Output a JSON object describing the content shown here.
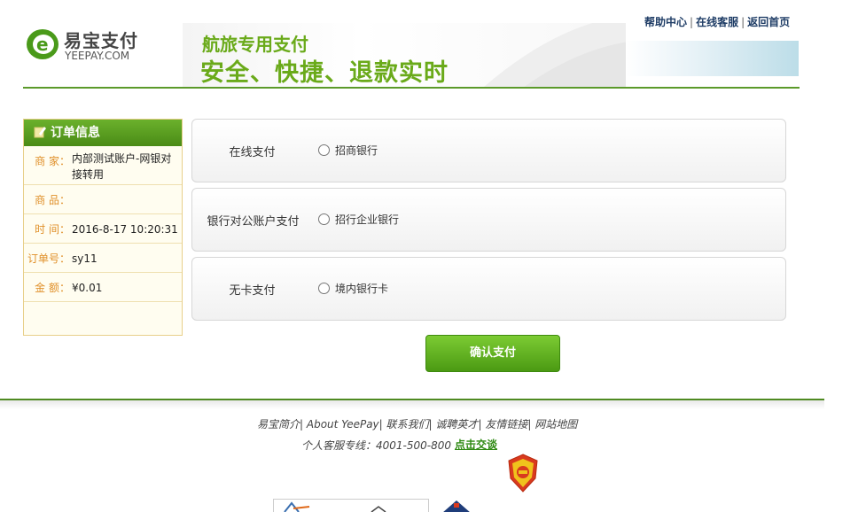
{
  "logo": {
    "cn": "易宝支付",
    "en": "YEEPAY.COM"
  },
  "banner": {
    "line1": "航旅专用支付",
    "line2": "安全、快捷、退款实时"
  },
  "top_links": [
    "帮助中心",
    "在线客服",
    "返回首页"
  ],
  "order": {
    "title": "订单信息",
    "rows": [
      {
        "label": "商 家：",
        "value": "内部测试账户-网银对接转用"
      },
      {
        "label": "商 品：",
        "value": ""
      },
      {
        "label": "时 间：",
        "value": "2016-8-17 10:20:31"
      },
      {
        "label": "订单号：",
        "value": "sy11"
      },
      {
        "label": "金 额：",
        "value": "¥0.01"
      }
    ]
  },
  "payment_methods": [
    {
      "title": "在线支付",
      "option": "招商银行"
    },
    {
      "title": "银行对公账户支付",
      "option": "招行企业银行"
    },
    {
      "title": "无卡支付",
      "option": "境内银行卡"
    }
  ],
  "confirm_label": "确认支付",
  "footer": {
    "links": [
      "易宝简介",
      "About YeePay",
      "联系我们",
      "诚聘英才",
      "友情链接",
      "网站地图"
    ],
    "hotline": "个人客服专线：4001-500-800",
    "chat_label": "点击交谈"
  },
  "colors": {
    "brand_green": "#5b9a2a",
    "label_orange": "#e0902a",
    "link_navy": "#1f3d66"
  }
}
